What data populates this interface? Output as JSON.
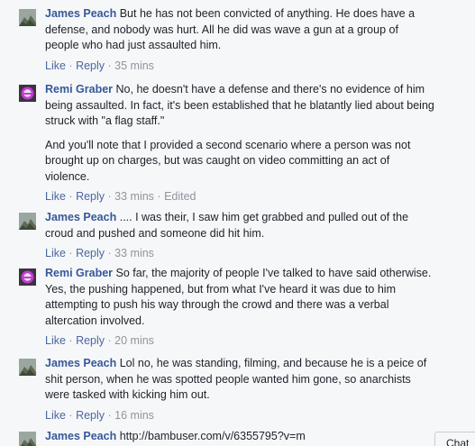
{
  "comments": [
    {
      "author": "James Peach",
      "avatar_icon": "landscape-avatar-icon",
      "text": "But he has not been convicted of anything. He does have a defense, and nobody was hurt. All he did was wave a gun at a group of people who had just assaulted him.",
      "extra": "",
      "like": "Like",
      "reply": "Reply",
      "time": "35 mins",
      "edited": ""
    },
    {
      "author": "Remi Graber",
      "avatar_icon": "purple-globe-avatar-icon",
      "text": "No, he doesn't have a defense and there's no evidence of him being assaulted. In fact, it's been established that he blatantly lied about being struck with \"a flag staff.\"",
      "extra": "And you'll note that I provided a second scenario where a person was not brought up on charges, but was caught on video committing an act of violence.",
      "like": "Like",
      "reply": "Reply",
      "time": "33 mins",
      "edited": "Edited"
    },
    {
      "author": "James Peach",
      "avatar_icon": "landscape-avatar-icon",
      "text": ".... I was their, I saw him get grabbed and pulled out of the croud and pushed and someone did hit him.",
      "extra": "",
      "like": "Like",
      "reply": "Reply",
      "time": "33 mins",
      "edited": ""
    },
    {
      "author": "Remi Graber",
      "avatar_icon": "purple-globe-avatar-icon",
      "text": "So far, the majority of people I've talked to have said otherwise. Yes, the pushing happened, but from what I've heard it was due to him attempting to push his way through the crowd and there was a verbal altercation involved.",
      "extra": "",
      "like": "Like",
      "reply": "Reply",
      "time": "20 mins",
      "edited": ""
    },
    {
      "author": "James Peach",
      "avatar_icon": "landscape-avatar-icon",
      "text": "Lol no, he was standing, filming, and because he is a peice of shit person, when he was spotted people wanted him gone, so anarchists were tasked with kicking him out.",
      "extra": "",
      "like": "Like",
      "reply": "Reply",
      "time": "16 mins",
      "edited": ""
    },
    {
      "author": "James Peach",
      "avatar_icon": "landscape-avatar-icon",
      "text": "http://bambuser.com/v/6355795?v=m",
      "extra": "",
      "like": "",
      "reply": "",
      "time": "",
      "edited": ""
    }
  ],
  "chat_tab": "Chat"
}
